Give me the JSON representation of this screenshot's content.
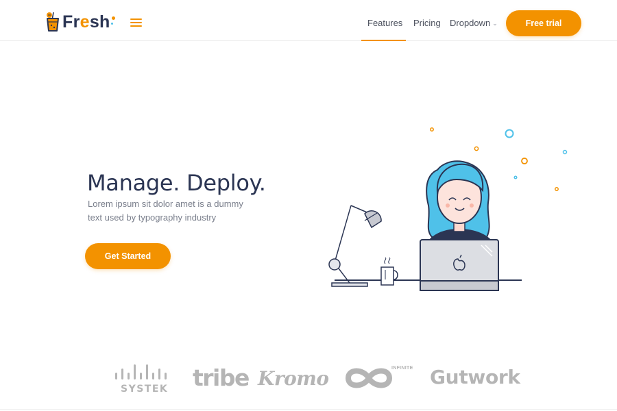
{
  "brand": {
    "name_prefix": "Fr",
    "name_accent": "e",
    "name_suffix": "sh",
    "accent_color": "#f39200",
    "secondary_color": "#4fc1e9",
    "text_color": "#2b3553"
  },
  "nav": {
    "menu_icon": "hamburger-menu-icon",
    "links": [
      {
        "label": "Features",
        "active": true
      },
      {
        "label": "Pricing",
        "active": false
      },
      {
        "label": "Dropdown",
        "active": false
      }
    ],
    "dropdown_icon": "chevron-down-icon",
    "cta_label": "Free trial"
  },
  "hero": {
    "title": "Manage. Deploy.",
    "subtitle": "Lorem ipsum sit dolor amet is a dummy text used by typography industry",
    "cta_label": "Get Started",
    "illustration": "woman-at-laptop-illustration"
  },
  "logos": [
    {
      "name": "cisco-systek-logo",
      "text": "SYSTEK"
    },
    {
      "name": "tribe-logo",
      "text": "tribe"
    },
    {
      "name": "kromo-logo",
      "text": "Kromo"
    },
    {
      "name": "infinite-logo",
      "text": "INFINITE"
    },
    {
      "name": "gutwork-logo",
      "text": "Gutwork"
    }
  ]
}
